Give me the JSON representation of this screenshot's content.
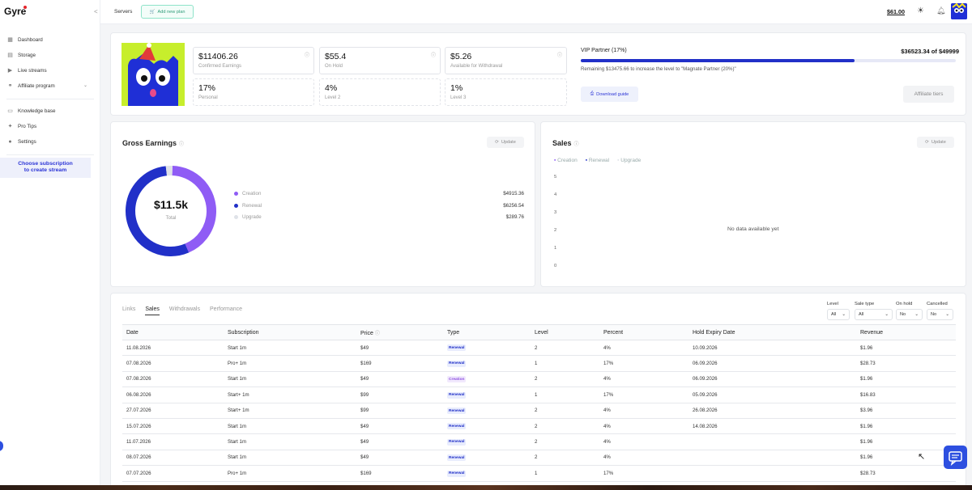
{
  "app": {
    "name": "Gyre"
  },
  "sidebar": {
    "items": [
      {
        "label": "Dashboard",
        "icon": "dashboard-icon"
      },
      {
        "label": "Storage",
        "icon": "storage-icon"
      },
      {
        "label": "Live streams",
        "icon": "play-icon"
      },
      {
        "label": "Affiliate program",
        "icon": "handshake-icon"
      },
      {
        "label": "Knowledge base",
        "icon": "book-icon"
      },
      {
        "label": "Pro Tips",
        "icon": "lightbulb-icon"
      },
      {
        "label": "Settings",
        "icon": "user-icon"
      }
    ],
    "promo_line1": "Choose subscription",
    "promo_line2": "to create stream"
  },
  "topbar": {
    "breadcrumb": "Servers",
    "add_plan_label": "Add new plan",
    "balance": "$61.00"
  },
  "stats": {
    "confirmed": {
      "value": "$11406.26",
      "label": "Confirmed Earnings"
    },
    "on_hold": {
      "value": "$55.4",
      "label": "On Hold"
    },
    "available": {
      "value": "$5.26",
      "label": "Available for Withdrawal"
    },
    "personal": {
      "value": "17%",
      "label": "Personal"
    },
    "level2": {
      "value": "4%",
      "label": "Level 2"
    },
    "level3": {
      "value": "1%",
      "label": "Level 3"
    }
  },
  "vip": {
    "label": "VIP Partner (17%)",
    "amount": "$36523.34 of $49999",
    "progress": 0.73,
    "note": "Remaining $13475.66 to increase the level to \"Magnate Partner (20%)\"",
    "download_label": "Download guide",
    "tiers_label": "Affiliate tiers"
  },
  "gross": {
    "title": "Gross Earnings",
    "update_label": "Update",
    "total": "$11.5k",
    "total_label": "Total",
    "legend": [
      {
        "name": "Creation",
        "amount": "$4915.36",
        "color": "#8f5cf5"
      },
      {
        "name": "Renewal",
        "amount": "$6256.54",
        "color": "#2130c8"
      },
      {
        "name": "Upgrade",
        "amount": "$289.76",
        "color": "#dfe2e8"
      }
    ]
  },
  "chart_data": {
    "type": "line",
    "title": "Sales",
    "series": [
      {
        "name": "Creation",
        "values": []
      },
      {
        "name": "Renewal",
        "values": []
      },
      {
        "name": "Upgrade",
        "values": []
      }
    ],
    "yticks": [
      "5",
      "4",
      "3",
      "2",
      "1",
      "0"
    ],
    "ylim": [
      0,
      5
    ],
    "empty_message": "No data available yet"
  },
  "sales_card": {
    "update_label": "Update"
  },
  "tabs": [
    "Links",
    "Sales",
    "Withdrawals",
    "Performance"
  ],
  "filters": [
    {
      "label": "Level",
      "value": "All"
    },
    {
      "label": "Sale type",
      "value": "All"
    },
    {
      "label": "On hold",
      "value": "No"
    },
    {
      "label": "Cancelled",
      "value": "No"
    }
  ],
  "table": {
    "headers": [
      "Date",
      "Subscription",
      "Price",
      "Type",
      "Level",
      "Percent",
      "Hold Expiry Date",
      "Revenue"
    ],
    "rows": [
      [
        "11.08.2026",
        "Start 1m",
        "$49",
        "Renewal",
        "2",
        "4%",
        "10.09.2026",
        "$1.96"
      ],
      [
        "07.08.2026",
        "Pro+ 1m",
        "$169",
        "Renewal",
        "1",
        "17%",
        "06.09.2026",
        "$28.73"
      ],
      [
        "07.08.2026",
        "Start 1m",
        "$49",
        "Creation",
        "2",
        "4%",
        "06.09.2026",
        "$1.96"
      ],
      [
        "06.08.2026",
        "Start+ 1m",
        "$99",
        "Renewal",
        "1",
        "17%",
        "05.09.2026",
        "$16.83"
      ],
      [
        "27.07.2026",
        "Start+ 1m",
        "$99",
        "Renewal",
        "2",
        "4%",
        "26.08.2026",
        "$3.96"
      ],
      [
        "15.07.2026",
        "Start 1m",
        "$49",
        "Renewal",
        "2",
        "4%",
        "14.08.2026",
        "$1.96"
      ],
      [
        "11.07.2026",
        "Start 1m",
        "$49",
        "Renewal",
        "2",
        "4%",
        "",
        "$1.96"
      ],
      [
        "08.07.2026",
        "Start 1m",
        "$49",
        "Renewal",
        "2",
        "4%",
        "",
        "$1.96"
      ],
      [
        "07.07.2026",
        "Pro+ 1m",
        "$169",
        "Renewal",
        "1",
        "17%",
        "",
        "$28.73"
      ]
    ]
  }
}
